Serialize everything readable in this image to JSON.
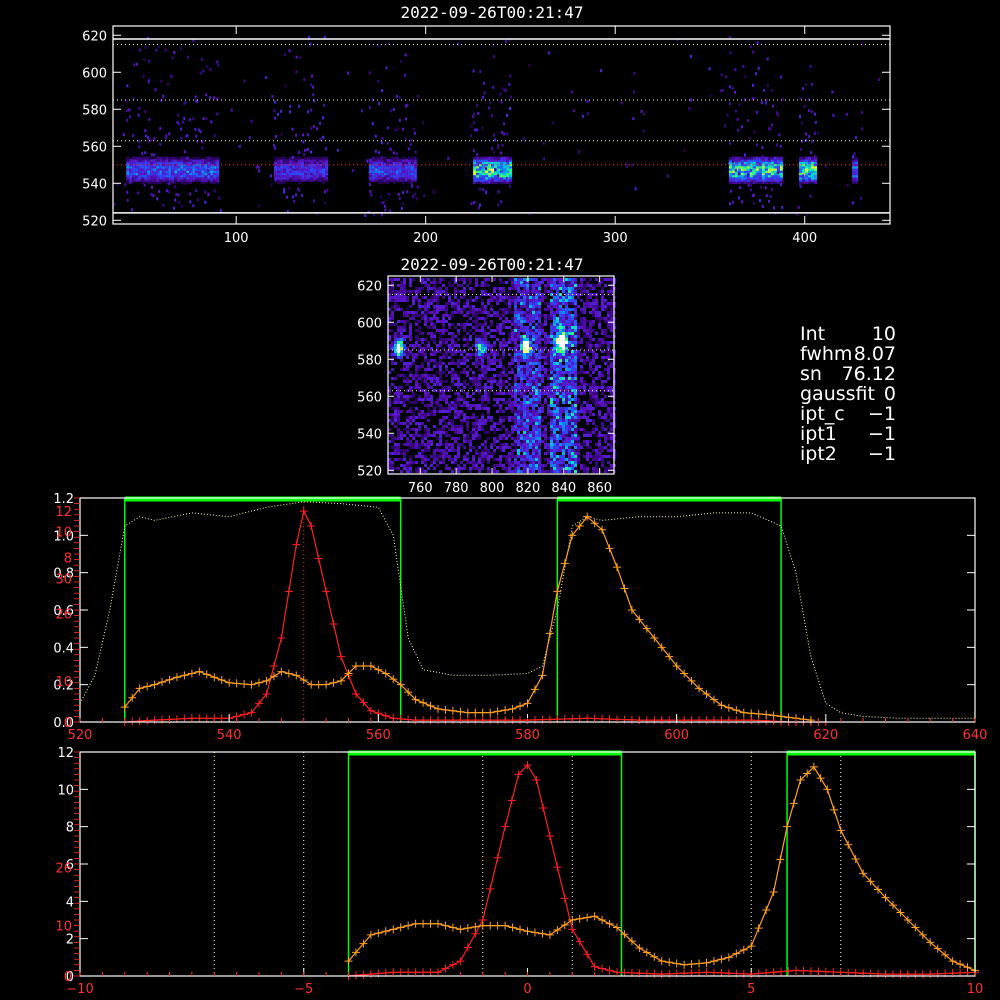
{
  "titles": {
    "top": "2022-09-26T00:21:47",
    "middle": "2022-09-26T00:21:47"
  },
  "info_panel": [
    {
      "label": "Int",
      "value": "10"
    },
    {
      "label": "fwhm",
      "value": "8.07"
    },
    {
      "label": "sn",
      "value": "76.12"
    },
    {
      "label": "gaussfit",
      "value": "0"
    },
    {
      "label": "ipt_c",
      "value": "−1"
    },
    {
      "label": "ipt1",
      "value": "−1"
    },
    {
      "label": "ipt2",
      "value": "−1"
    }
  ],
  "colors": {
    "frame": "#ffffff",
    "red_series": "#ff2020",
    "orange_series": "#ffa020",
    "green_window": "#00ff00",
    "yellow_guide": "#ffffa0",
    "red_axis": "#ff3030"
  },
  "chart_data": [
    {
      "type": "heatmap",
      "title": "2022-09-26T00:21:47",
      "xlim": [
        35,
        445
      ],
      "ylim": [
        518,
        625
      ],
      "xticks": [
        100,
        200,
        300,
        400
      ],
      "yticks": [
        520,
        540,
        560,
        580,
        600,
        620
      ],
      "hlines_white": [
        524,
        618
      ],
      "hlines_yellow": [
        563,
        585,
        615
      ],
      "hlines_red": [
        550
      ],
      "bands": [
        {
          "x0": 42,
          "x1": 90,
          "intensity": 0.55
        },
        {
          "x0": 120,
          "x1": 147,
          "intensity": 0.45
        },
        {
          "x0": 170,
          "x1": 194,
          "intensity": 0.5
        },
        {
          "x0": 225,
          "x1": 244,
          "intensity": 0.85
        },
        {
          "x0": 360,
          "x1": 388,
          "intensity": 0.8
        },
        {
          "x0": 397,
          "x1": 405,
          "intensity": 0.85
        },
        {
          "x0": 425,
          "x1": 428,
          "intensity": 0.6
        }
      ],
      "band_center_y": 548
    },
    {
      "type": "heatmap",
      "title": "2022-09-26T00:21:47",
      "xlim": [
        742,
        868
      ],
      "ylim": [
        518,
        625
      ],
      "xticks": [
        760,
        780,
        800,
        820,
        840,
        860
      ],
      "yticks": [
        520,
        540,
        560,
        580,
        600,
        620
      ],
      "hlines_yellow": [
        563,
        585,
        615
      ],
      "blobs": [
        {
          "x": 747,
          "y": 587,
          "intensity": 0.7
        },
        {
          "x": 793,
          "y": 587,
          "intensity": 0.5
        },
        {
          "x": 818,
          "y": 588,
          "intensity": 0.75
        },
        {
          "x": 838,
          "y": 590,
          "intensity": 1.0
        }
      ],
      "stripes": [
        {
          "x0": 811,
          "x1": 826,
          "intensity": 0.35
        },
        {
          "x0": 831,
          "x1": 846,
          "intensity": 0.45
        }
      ]
    },
    {
      "type": "line",
      "xlim": [
        520,
        640
      ],
      "ylim": [
        0,
        1.2
      ],
      "xticks": [
        520,
        540,
        560,
        580,
        600,
        620,
        640
      ],
      "yticks": [
        0.0,
        0.2,
        0.4,
        0.6,
        0.8,
        1.0,
        1.2
      ],
      "ytick_labels": [
        "0.0",
        "0.2",
        "0.4",
        "0.6",
        "0.8",
        "1.0",
        "1.2"
      ],
      "yticks_red": [
        0,
        10,
        26,
        30,
        8,
        10,
        12
      ],
      "red_tick_positions": [
        0.0,
        0.22,
        0.58,
        0.77,
        0.88,
        1.02,
        1.13
      ],
      "windows": [
        [
          526,
          563
        ],
        [
          584,
          614
        ]
      ],
      "center_line": 550,
      "series": [
        {
          "name": "",
          "style": "yellow-dotted",
          "x": [
            520,
            522,
            524,
            526,
            528,
            530,
            535,
            540,
            545,
            550,
            555,
            560,
            562,
            564,
            566,
            570,
            575,
            580,
            582,
            584,
            586,
            588,
            590,
            595,
            600,
            605,
            610,
            614,
            616,
            618,
            620,
            622,
            625,
            630,
            635,
            640
          ],
          "y": [
            0.1,
            0.25,
            0.6,
            1.05,
            1.1,
            1.08,
            1.12,
            1.1,
            1.15,
            1.18,
            1.17,
            1.15,
            1.0,
            0.45,
            0.28,
            0.25,
            0.25,
            0.26,
            0.3,
            0.6,
            1.05,
            1.1,
            1.08,
            1.1,
            1.1,
            1.12,
            1.12,
            1.05,
            0.8,
            0.35,
            0.1,
            0.05,
            0.03,
            0.02,
            0.02,
            0.02
          ]
        },
        {
          "name": "",
          "style": "red-plus",
          "x": [
            526,
            530,
            535,
            540,
            543,
            545,
            547,
            549,
            550,
            551,
            553,
            555,
            557,
            559,
            562,
            565,
            570,
            580,
            588,
            595,
            600,
            605,
            610,
            615,
            620
          ],
          "y": [
            0.0,
            0.01,
            0.02,
            0.02,
            0.05,
            0.15,
            0.45,
            0.95,
            1.13,
            1.05,
            0.7,
            0.35,
            0.15,
            0.06,
            0.02,
            0.01,
            0.01,
            0.01,
            0.02,
            0.01,
            0.01,
            0.01,
            0.01,
            0.0,
            0.0
          ]
        },
        {
          "name": "",
          "style": "orange-plus",
          "x": [
            526,
            528,
            530,
            533,
            536,
            538,
            540,
            543,
            545,
            547,
            549,
            551,
            553,
            555,
            557,
            559,
            561,
            563,
            565,
            568,
            572,
            575,
            578,
            580,
            582,
            584,
            586,
            588,
            590,
            592,
            594,
            596,
            598,
            600,
            603,
            606,
            609,
            612,
            614,
            616,
            618
          ],
          "y": [
            0.08,
            0.18,
            0.2,
            0.24,
            0.27,
            0.24,
            0.21,
            0.2,
            0.22,
            0.27,
            0.25,
            0.2,
            0.2,
            0.22,
            0.3,
            0.3,
            0.26,
            0.2,
            0.12,
            0.07,
            0.05,
            0.05,
            0.07,
            0.1,
            0.25,
            0.7,
            1.0,
            1.1,
            1.03,
            0.83,
            0.6,
            0.5,
            0.4,
            0.3,
            0.18,
            0.09,
            0.05,
            0.04,
            0.03,
            0.02,
            0.01
          ]
        }
      ]
    },
    {
      "type": "line",
      "xlim": [
        -10,
        10
      ],
      "ylim": [
        0,
        1.2
      ],
      "xticks": [
        -10,
        -5,
        0,
        5,
        10
      ],
      "xtick_labels": [
        "−10",
        "−5",
        "0",
        "5",
        "10"
      ],
      "yticks": [
        0.0,
        0.2,
        0.4,
        0.6,
        0.8,
        1.0,
        1.2
      ],
      "ytick_labels": [
        "0",
        "2",
        "4",
        "6",
        "8",
        "10",
        "12"
      ],
      "yticks_red": [
        0,
        10,
        26
      ],
      "red_tick_positions": [
        0.0,
        0.27,
        0.58
      ],
      "windows": [
        [
          -4,
          2.1
        ],
        [
          5.8,
          10
        ]
      ],
      "dotted_white": [
        -5,
        1,
        7
      ],
      "dotted_yellow": [
        -7,
        -1,
        5
      ],
      "series": [
        {
          "name": "",
          "style": "red-plus",
          "x": [
            -4,
            -3,
            -2,
            -1.5,
            -1,
            -0.5,
            -0.2,
            0,
            0.2,
            0.5,
            1,
            1.5,
            2,
            3,
            4,
            5,
            6,
            7,
            8,
            9,
            10
          ],
          "y": [
            0.0,
            0.02,
            0.02,
            0.08,
            0.3,
            0.8,
            1.08,
            1.13,
            1.05,
            0.75,
            0.25,
            0.05,
            0.02,
            0.01,
            0.02,
            0.01,
            0.03,
            0.02,
            0.01,
            0.01,
            0.02
          ]
        },
        {
          "name": "",
          "style": "orange-plus",
          "x": [
            -4,
            -3.5,
            -3,
            -2.5,
            -2,
            -1.5,
            -1,
            -0.5,
            0,
            0.5,
            1,
            1.5,
            2,
            2.5,
            3,
            3.5,
            4,
            4.5,
            5,
            5.5,
            5.8,
            6.1,
            6.4,
            6.7,
            7,
            7.5,
            8,
            8.5,
            9,
            9.5,
            10
          ],
          "y": [
            0.08,
            0.22,
            0.25,
            0.28,
            0.28,
            0.25,
            0.27,
            0.27,
            0.24,
            0.22,
            0.3,
            0.32,
            0.26,
            0.15,
            0.08,
            0.06,
            0.07,
            0.1,
            0.16,
            0.45,
            0.8,
            1.05,
            1.12,
            1.0,
            0.78,
            0.55,
            0.42,
            0.3,
            0.18,
            0.08,
            0.03
          ]
        }
      ]
    }
  ]
}
